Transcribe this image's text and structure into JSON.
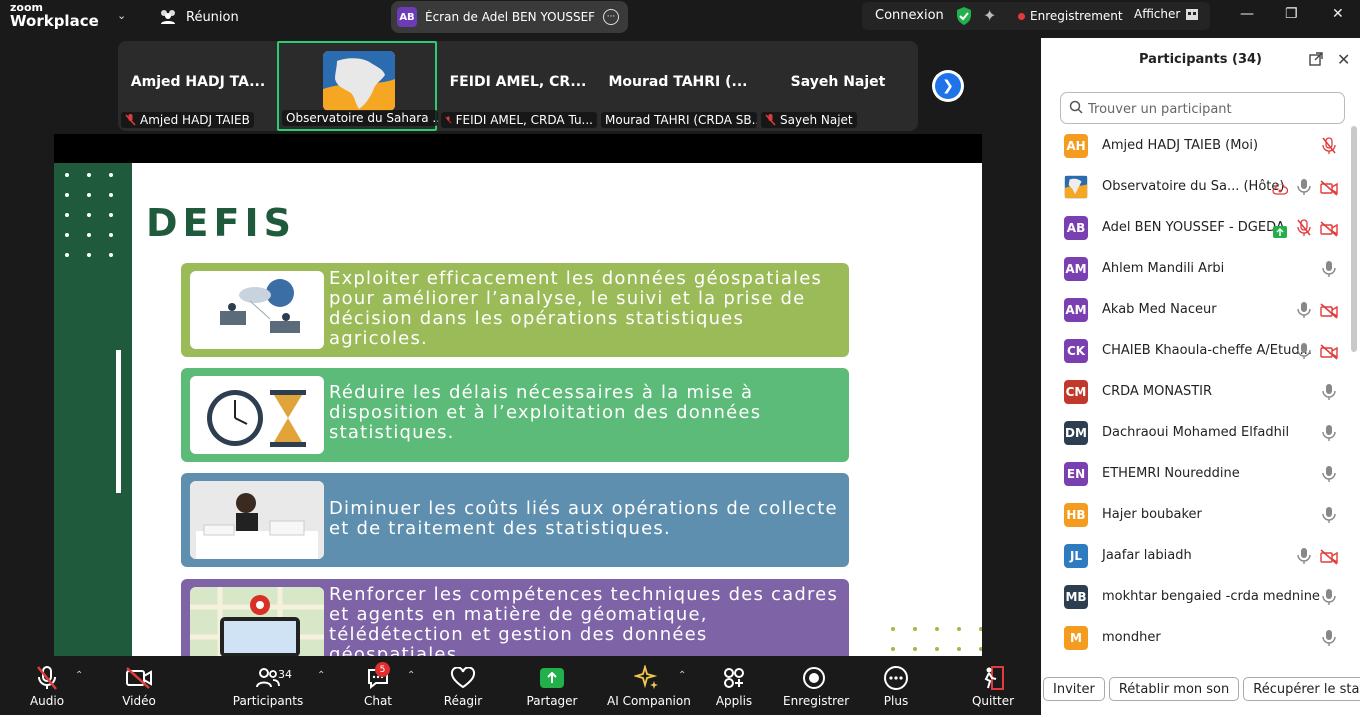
{
  "app": {
    "logo_line1": "zoom",
    "logo_line2": "Workplace",
    "meeting_label": "Réunion"
  },
  "share_pill": {
    "avatar": "AB",
    "text": "Écran de Adel BEN YOUSSEF - DGEDA"
  },
  "status": {
    "connexion": "Connexion",
    "recording": "Enregistrement",
    "afficher": "Afficher"
  },
  "thumbnails": [
    {
      "big": "Amjed HADJ TA...",
      "tag": "Amjed HADJ TAIEB",
      "muted": true
    },
    {
      "big": "",
      "tag": "Observatoire du Sahara ...",
      "muted": false,
      "active": true
    },
    {
      "big": "FEIDI AMEL, CR...",
      "tag": "FEIDI AMEL, CRDA Tu...",
      "muted": true
    },
    {
      "big": "Mourad TAHRI (...",
      "tag": "Mourad TAHRI (CRDA SB...",
      "muted": false
    },
    {
      "big": "Sayeh Najet",
      "tag": "Sayeh Najet",
      "muted": true
    }
  ],
  "slide": {
    "title": "DEFIS",
    "cards": [
      {
        "text": "Exploiter efficacement les données géospatiales pour améliorer l’analyse, le suivi et la prise de décision dans les opérations statistiques agricoles.",
        "color": "#9bbb59"
      },
      {
        "text": "Réduire les délais nécessaires à la mise à disposition et à l’exploitation des données statistiques.",
        "color": "#5dbb7a"
      },
      {
        "text": "Diminuer les coûts liés aux opérations de collecte et de traitement des statistiques.",
        "color": "#5f8fae"
      },
      {
        "text": "Renforcer les compétences techniques des cadres et agents en matière de géomatique, télédétection et gestion des données géospatiales.",
        "color": "#7e63a6"
      }
    ]
  },
  "panel": {
    "title": "Participants (34)",
    "search_placeholder": "Trouver un participant",
    "participants": [
      {
        "initials": "AH",
        "name": "Amjed HADJ TAIEB (Moi)",
        "color": "#f39c1f",
        "mic": "muted",
        "cam": "none"
      },
      {
        "initials": "",
        "name": "Observatoire du Sa...  (Hôte)",
        "color": "#ffffff",
        "mic": "on",
        "cam": "off",
        "logo": true,
        "cloud": true
      },
      {
        "initials": "AB",
        "name": "Adel BEN YOUSSEF - DGEDA",
        "color": "#7a3fb0",
        "mic": "muted",
        "cam": "off",
        "sharing": true
      },
      {
        "initials": "AM",
        "name": "Ahlem Mandili Arbi",
        "color": "#7a3fb0",
        "mic": "on",
        "cam": "none"
      },
      {
        "initials": "AM",
        "name": "Akab Med Naceur",
        "color": "#7a3fb0",
        "mic": "on",
        "cam": "off"
      },
      {
        "initials": "CK",
        "name": "CHAIEB Khaoula-cheffe A/Etud...",
        "color": "#7a3fb0",
        "mic": "on",
        "cam": "off"
      },
      {
        "initials": "CM",
        "name": "CRDA MONASTIR",
        "color": "#c0392b",
        "mic": "on",
        "cam": "none"
      },
      {
        "initials": "DM",
        "name": "Dachraoui Mohamed Elfadhil",
        "color": "#2c3e50",
        "mic": "on",
        "cam": "none"
      },
      {
        "initials": "EN",
        "name": "ETHEMRI Noureddine",
        "color": "#7a3fb0",
        "mic": "on",
        "cam": "none"
      },
      {
        "initials": "HB",
        "name": "Hajer boubaker",
        "color": "#f39c1f",
        "mic": "on",
        "cam": "none"
      },
      {
        "initials": "JL",
        "name": "Jaafar labiadh",
        "color": "#2e7bbf",
        "mic": "on",
        "cam": "off"
      },
      {
        "initials": "MB",
        "name": "mokhtar bengaied -crda mednine",
        "color": "#2c3e50",
        "mic": "on",
        "cam": "none"
      },
      {
        "initials": "M",
        "name": "mondher",
        "color": "#f39c1f",
        "mic": "on",
        "cam": "none"
      }
    ],
    "buttons": [
      "Inviter",
      "Rétablir mon son",
      "Récupérer le statut d"
    ]
  },
  "toolbar": {
    "audio": "Audio",
    "video": "Vidéo",
    "participants": "Participants",
    "participants_count": "34",
    "chat": "Chat",
    "chat_badge": "5",
    "react": "Réagir",
    "share": "Partager",
    "ai": "AI Companion",
    "apps": "Applis",
    "record": "Enregistrer",
    "more": "Plus",
    "quit": "Quitter"
  }
}
